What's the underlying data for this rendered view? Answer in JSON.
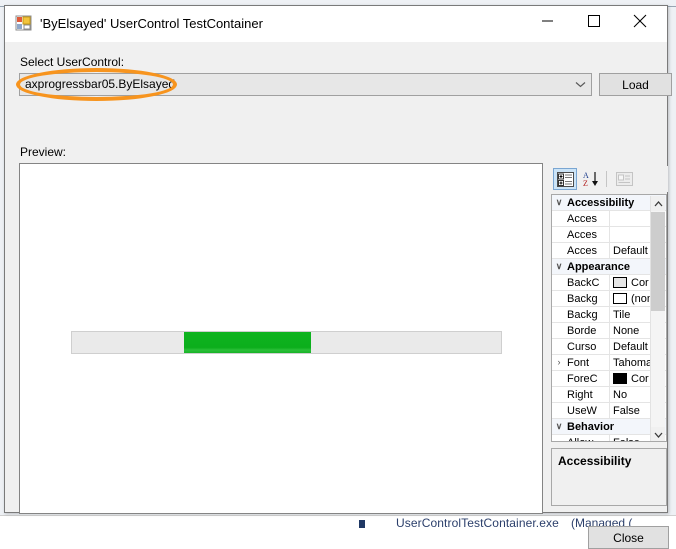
{
  "window": {
    "title": "'ByElsayed' UserControl TestContainer",
    "icon": "usercontrol-app-icon",
    "controls": {
      "minimize": "minimize-icon",
      "maximize": "maximize-icon",
      "close": "close-icon"
    }
  },
  "form": {
    "select_label": "Select UserControl:",
    "combo_value": "axprogressbar05.ByElsayed",
    "combo_placeholder": "",
    "load_label": "Load",
    "preview_label": "Preview:",
    "close_label": "Close"
  },
  "highlight": {
    "color": "#f7941e",
    "target": "combo_value"
  },
  "preview": {
    "control_type": "progressbar",
    "track_color": "#eaeaea",
    "chunk_color": "#0cae1c",
    "chunk_offset_pct": 26,
    "chunk_width_pct": 30
  },
  "propertygrid": {
    "toolbar": [
      {
        "name": "categorized-view-button",
        "label": "Categorized",
        "selected": true
      },
      {
        "name": "alphabetical-view-button",
        "label": "Alphabetical",
        "selected": false
      },
      {
        "name": "property-pages-button",
        "label": "Property Pages",
        "selected": false,
        "disabled": true
      }
    ],
    "rows": [
      {
        "kind": "category",
        "expander": "∨",
        "name": "Accessibility",
        "value": ""
      },
      {
        "kind": "prop",
        "expander": "",
        "name": "Acces",
        "value": ""
      },
      {
        "kind": "prop",
        "expander": "",
        "name": "Acces",
        "value": ""
      },
      {
        "kind": "prop",
        "expander": "",
        "name": "Acces",
        "value": "Default"
      },
      {
        "kind": "category",
        "expander": "∨",
        "name": "Appearance",
        "value": ""
      },
      {
        "kind": "prop",
        "expander": "",
        "name": "BackC",
        "value": "Cor",
        "swatch": "#e6e6e6"
      },
      {
        "kind": "prop",
        "expander": "",
        "name": "Backg",
        "value": "(non",
        "swatch": "#ffffff"
      },
      {
        "kind": "prop",
        "expander": "",
        "name": "Backg",
        "value": "Tile"
      },
      {
        "kind": "prop",
        "expander": "",
        "name": "Borde",
        "value": "None"
      },
      {
        "kind": "prop",
        "expander": "",
        "name": "Curso",
        "value": "Default"
      },
      {
        "kind": "prop",
        "expander": "›",
        "name": "Font",
        "value": "Tahoma;"
      },
      {
        "kind": "prop",
        "expander": "",
        "name": "ForeC",
        "value": "Cor",
        "swatch": "#000000"
      },
      {
        "kind": "prop",
        "expander": "",
        "name": "Right",
        "value": "No"
      },
      {
        "kind": "prop",
        "expander": "",
        "name": "UseW",
        "value": "False"
      },
      {
        "kind": "category",
        "expander": "∨",
        "name": "Behavior",
        "value": ""
      },
      {
        "kind": "prop",
        "expander": "",
        "name": "Allow",
        "value": "False"
      }
    ],
    "description_title": "Accessibility",
    "description_body": ""
  },
  "background": {
    "process_name": "UserControlTestContainer.exe",
    "process_type": "(Managed ("
  }
}
